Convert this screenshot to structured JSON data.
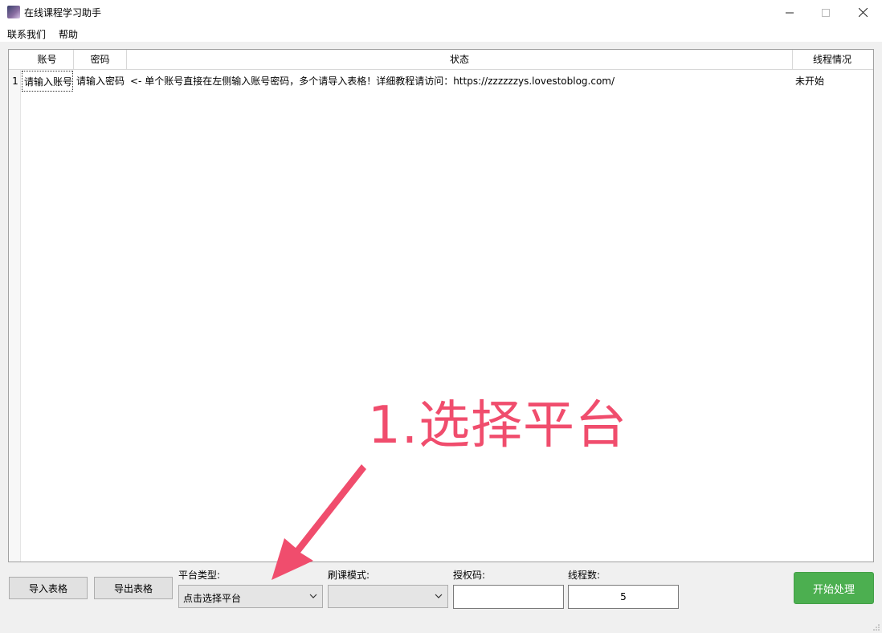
{
  "window": {
    "title": "在线课程学习助手",
    "icon": "app-logo-icon",
    "controls": {
      "minimize": "—",
      "maximize": "☐",
      "close": "✕"
    }
  },
  "menu": {
    "contact": "联系我们",
    "help": "帮助"
  },
  "table": {
    "columns": {
      "account": "账号",
      "password": "密码",
      "status": "状态",
      "thread": "线程情况"
    },
    "rows": [
      {
        "num": "1",
        "account": "请输入账号",
        "password": "请输入密码",
        "status": "<- 单个账号直接在左侧输入账号密码，多个请导入表格！详细教程请访问：https://zzzzzzys.lovestoblog.com/",
        "thread": "未开始"
      }
    ]
  },
  "controls": {
    "import_label": "导入表格",
    "export_label": "导出表格",
    "platform_label": "平台类型:",
    "platform_value": "点击选择平台",
    "mode_label": "刷课模式:",
    "mode_value": "",
    "auth_label": "授权码:",
    "auth_value": "",
    "threads_label": "线程数:",
    "threads_value": "5",
    "start_label": "开始处理"
  },
  "annotation": {
    "text": "1.选择平台",
    "color": "#f04d6d"
  },
  "colors": {
    "accent_green": "#4caf50",
    "annotation_red": "#f04d6d"
  }
}
